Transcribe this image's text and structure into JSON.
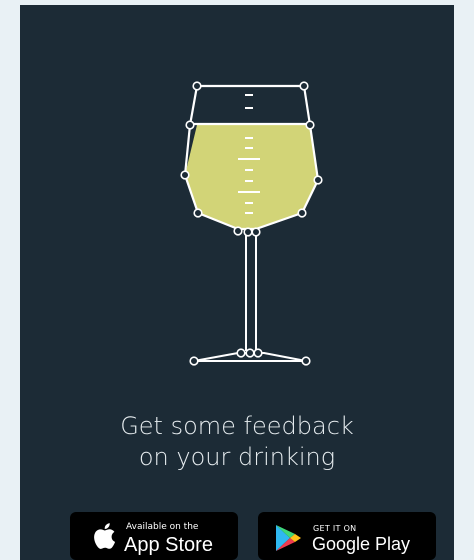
{
  "promo": {
    "headline_line1": "Get some feedback",
    "headline_line2": "on your drinking",
    "illustration": "wine-glass-icon"
  },
  "badges": {
    "app_store": {
      "small_text": "Available on the",
      "big_text": "App Store",
      "icon": "apple-logo-icon"
    },
    "google_play": {
      "small_text": "GET IT ON",
      "big_text": "Google Play",
      "icon": "google-play-logo-icon"
    }
  },
  "colors": {
    "page_background": "#e9f1f5",
    "card_background": "#1c2b36",
    "wine_fill": "#d2d477",
    "line": "#ffffff",
    "badge_background": "#000000"
  }
}
